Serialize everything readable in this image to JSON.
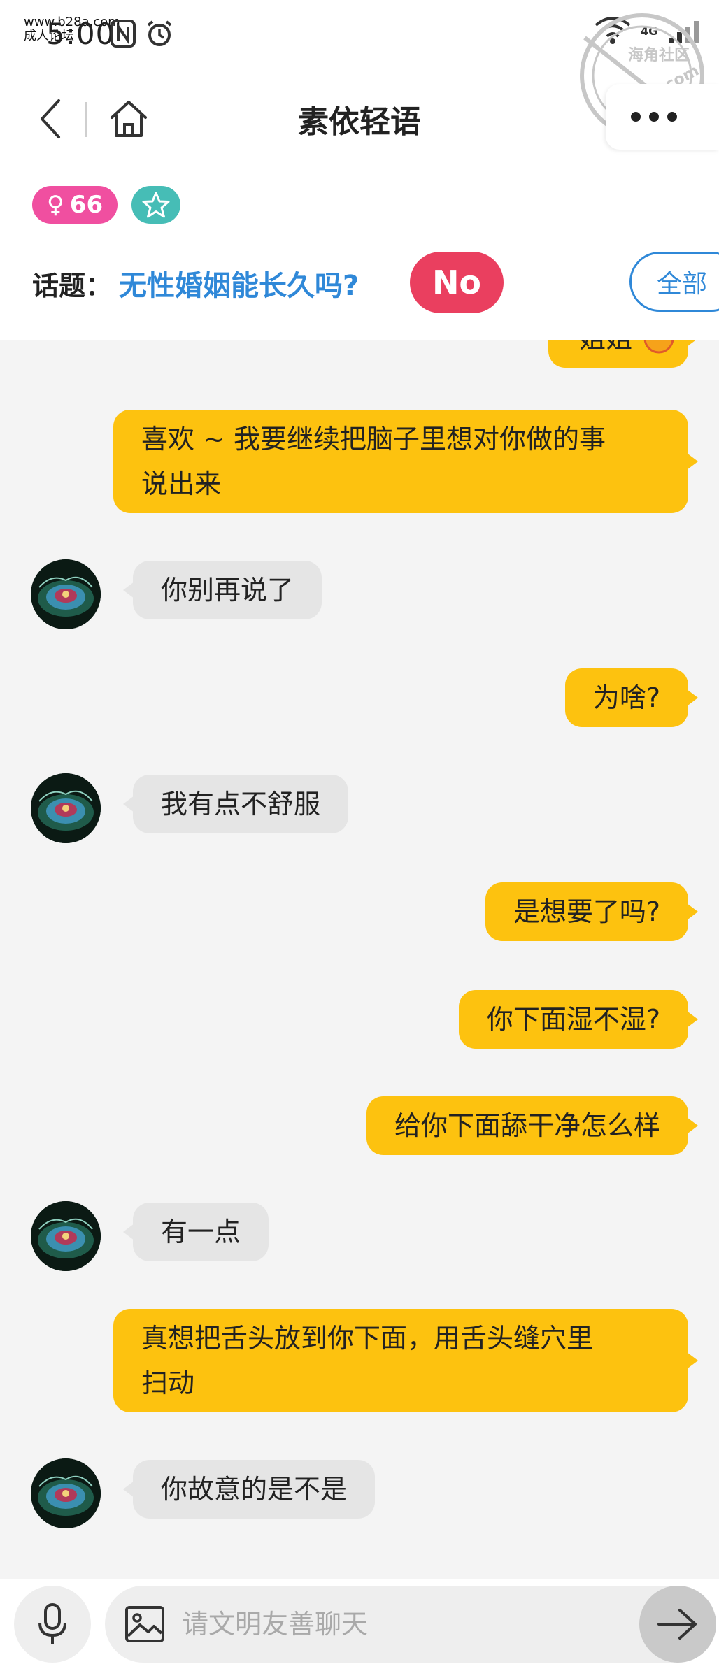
{
  "watermark": {
    "url": "www.b28a.com",
    "site_name": "成人论坛"
  },
  "status_bar": {
    "time": "5:00",
    "network": "4G"
  },
  "stamp": {
    "text": "海角社区",
    "domain": "haijiao.com"
  },
  "header": {
    "title": "素依轻语"
  },
  "profile_badges": {
    "gender_symbol": "♀",
    "age": "66"
  },
  "topic": {
    "label": "话题：",
    "text": "无性婚姻能长久吗?",
    "no_button": "No",
    "all_button": "全部"
  },
  "messages": [
    {
      "side": "out",
      "lines": [
        "姐姐"
      ]
    },
    {
      "side": "out",
      "lines": [
        "喜欢 ~ 我要继续把脑子里想对你做的事",
        "说出来"
      ]
    },
    {
      "side": "in",
      "lines": [
        "你别再说了"
      ]
    },
    {
      "side": "out",
      "lines": [
        "为啥?"
      ]
    },
    {
      "side": "in",
      "lines": [
        "我有点不舒服"
      ]
    },
    {
      "side": "out",
      "lines": [
        "是想要了吗?"
      ]
    },
    {
      "side": "out",
      "lines": [
        "你下面湿不湿?"
      ]
    },
    {
      "side": "out",
      "lines": [
        "给你下面舔干净怎么样"
      ]
    },
    {
      "side": "in",
      "lines": [
        "有一点"
      ]
    },
    {
      "side": "out",
      "lines": [
        "真想把舌头放到你下面，用舌头缝穴里",
        "扫动"
      ]
    },
    {
      "side": "in",
      "lines": [
        "你故意的是不是"
      ]
    }
  ],
  "input": {
    "placeholder": "请文明友善聊天"
  },
  "colors": {
    "outgoing_bubble": "#fdc20f",
    "incoming_bubble": "#e5e5e5",
    "topic_blue": "#2f88d8",
    "no_red": "#ea3f5f",
    "gender_pink": "#f04fa0",
    "star_teal": "#46bdb6"
  }
}
